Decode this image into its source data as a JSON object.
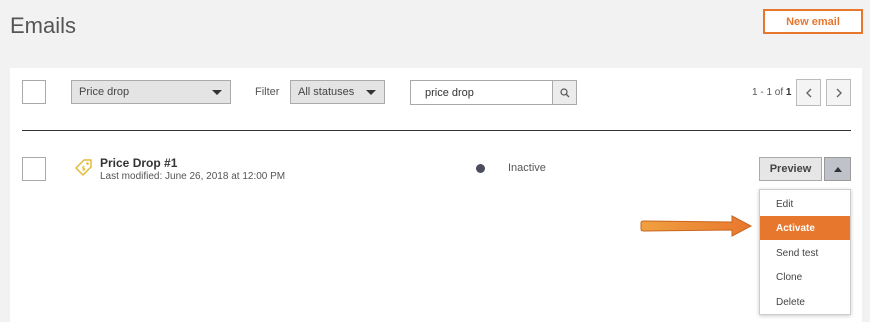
{
  "page": {
    "title": "Emails"
  },
  "header": {
    "new_email_label": "New email"
  },
  "toolbar": {
    "category_select": "Price drop",
    "filter_label": "Filter",
    "status_select": "All statuses",
    "search_value": "price drop",
    "pager_prefix": "1 - 1 of ",
    "pager_total": "1"
  },
  "email": {
    "title": "Price Drop #1",
    "meta": "Last modified: June 26, 2018 at 12:00 PM",
    "status": "Inactive",
    "status_color": "#4a4e5c",
    "preview_label": "Preview"
  },
  "menu": {
    "items": [
      {
        "label": "Edit"
      },
      {
        "label": "Activate",
        "highlighted": true
      },
      {
        "label": "Send test"
      },
      {
        "label": "Clone"
      },
      {
        "label": "Delete"
      }
    ]
  },
  "colors": {
    "accent": "#e8772e",
    "background": "#f2f2f2"
  },
  "icons": [
    "search-icon",
    "chevron-left-icon",
    "chevron-right-icon",
    "tag-icon",
    "caret-up-icon",
    "caret-down-icon",
    "pointer-arrow-icon"
  ]
}
